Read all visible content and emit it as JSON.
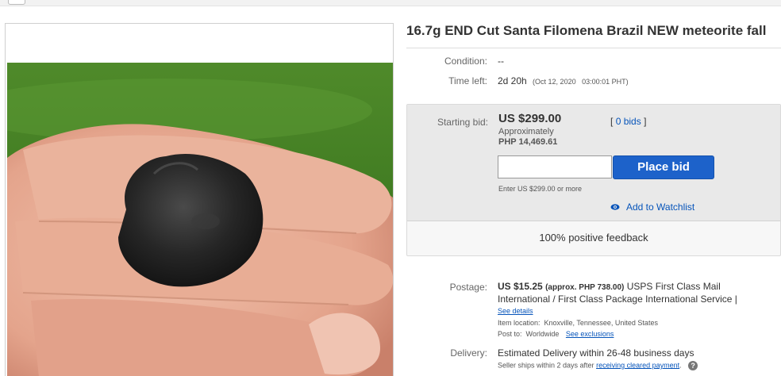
{
  "listing": {
    "title": "16.7g END Cut Santa Filomena Brazil NEW meteorite fall"
  },
  "details": {
    "condition_label": "Condition:",
    "condition_value": "--",
    "time_left_label": "Time left:",
    "time_left_value": "2d 20h",
    "end_time": "(Oct 12, 2020   03:00:01 PHT)"
  },
  "bid": {
    "starting_bid_label": "Starting bid:",
    "price": "US $299.00",
    "approx_label": "Approximately",
    "approx_php": "PHP 14,469.61",
    "bids_open": "[",
    "bids_link": "0 bids",
    "bids_close": "]",
    "input_value": "",
    "place_bid_label": "Place bid",
    "enter_hint": "Enter US $299.00 or more",
    "watchlist_label": "Add to Watchlist",
    "feedback": "100% positive feedback"
  },
  "shipping": {
    "postage_label": "Postage:",
    "postage_price": "US $15.25",
    "postage_approx": "(approx. PHP 738.00)",
    "service_line1": "USPS First Class Mail",
    "service_line2": "International / First Class Package International Service |",
    "see_details": "See details",
    "item_location": "Item location:  Knoxville, Tennessee, United States",
    "post_to_label": "Post to:  Worldwide",
    "see_exclusions": "See exclusions",
    "delivery_label": "Delivery:",
    "delivery_value": "Estimated Delivery within 26-48 business days",
    "seller_ships": "Seller ships within 2 days after",
    "payment_link": "receiving cleared payment",
    "period": "."
  },
  "colors": {
    "link": "#0654ba",
    "button": "#1d62ca"
  }
}
